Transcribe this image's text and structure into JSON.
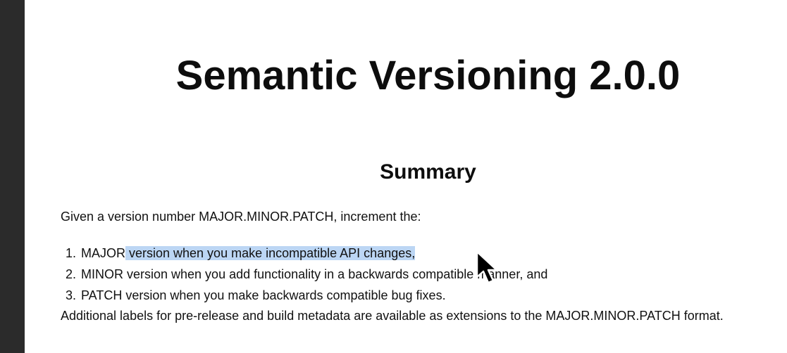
{
  "document": {
    "title": "Semantic Versioning 2.0.0",
    "section_heading": "Summary",
    "intro": "Given a version number MAJOR.MINOR.PATCH, increment the:",
    "list": [
      {
        "number": "1.",
        "term": "MAJOR",
        "text": " version when you make incompatible API changes,",
        "selected": true
      },
      {
        "number": "2.",
        "term": "MINOR",
        "text": " version when you add functionality in a backwards compatible manner, and",
        "selected": false
      },
      {
        "number": "3.",
        "term": "PATCH",
        "text": " version when you make backwards compatible bug fixes.",
        "selected": false
      }
    ],
    "footer": "Additional labels for pre-release and build metadata are available as extensions to the MAJOR.MINOR.PATCH format."
  },
  "selection": {
    "color": "#bcd6f4"
  },
  "cursor": {
    "icon": "arrow-pointer-icon"
  }
}
